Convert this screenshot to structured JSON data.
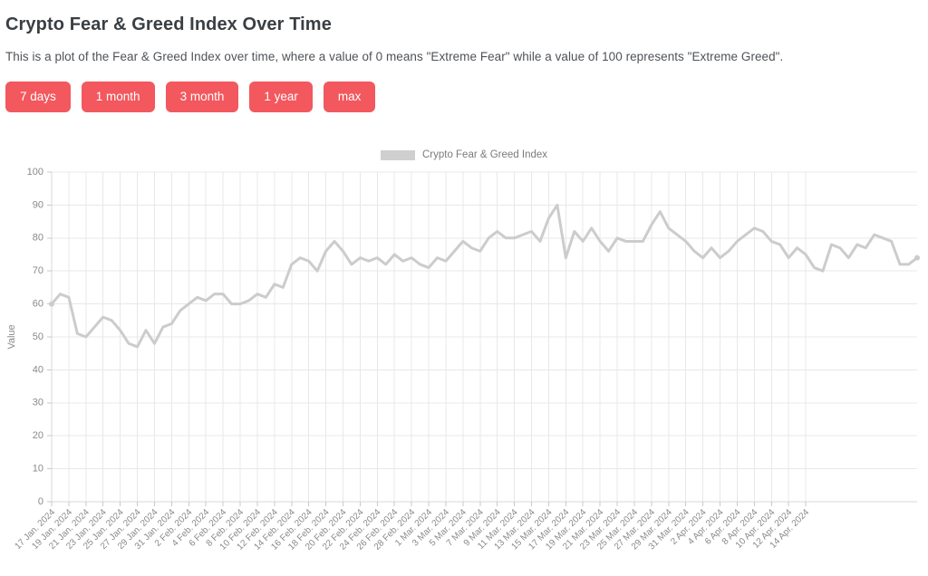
{
  "header": {
    "title": "Crypto Fear & Greed Index Over Time",
    "description": "This is a plot of the Fear & Greed Index over time, where a value of 0 means \"Extreme Fear\" while a value of 100 represents \"Extreme Greed\"."
  },
  "range_buttons": [
    {
      "label": "7 days"
    },
    {
      "label": "1 month"
    },
    {
      "label": "3 month"
    },
    {
      "label": "1 year"
    },
    {
      "label": "max"
    }
  ],
  "colors": {
    "button_background": "#f2585d",
    "button_text": "#ffffff",
    "series": "#cccccc",
    "grid": "#e8e8e8",
    "tick_text": "#8a8a8a",
    "title_text": "#3a3f44"
  },
  "chart_data": {
    "type": "line",
    "title": "",
    "xlabel": "",
    "ylabel": "Value",
    "ylim": [
      0,
      100
    ],
    "ytick_step": 10,
    "yticks": [
      0,
      10,
      20,
      30,
      40,
      50,
      60,
      70,
      80,
      90,
      100
    ],
    "grid": true,
    "legend_position": "top-center",
    "legend": [
      "Crypto Fear & Greed Index"
    ],
    "series": [
      {
        "name": "Crypto Fear & Greed Index",
        "color": "#cccccc",
        "values": [
          60,
          63,
          62,
          51,
          50,
          53,
          56,
          55,
          52,
          48,
          47,
          52,
          48,
          53,
          54,
          58,
          60,
          62,
          61,
          63,
          63,
          60,
          60,
          61,
          63,
          62,
          66,
          65,
          72,
          74,
          73,
          70,
          76,
          79,
          76,
          72,
          74,
          73,
          74,
          72,
          75,
          73,
          74,
          72,
          71,
          74,
          73,
          76,
          79,
          77,
          76,
          80,
          82,
          80,
          80,
          81,
          82,
          79,
          86,
          90,
          74,
          82,
          79,
          83,
          79,
          76,
          80,
          79,
          79,
          79,
          84,
          88,
          83,
          81,
          79,
          76,
          74,
          77,
          74,
          76,
          79,
          81,
          83,
          82,
          79,
          78,
          74,
          77,
          75,
          71,
          70,
          78,
          77,
          74,
          78,
          77,
          81,
          80,
          79,
          72,
          72,
          74
        ]
      }
    ],
    "x_start_date": "17 Jan. 2024",
    "x_end_date": "14 Apr. 2024",
    "xticks": [
      "17 Jan. 2024",
      "19 Jan. 2024",
      "21 Jan. 2024",
      "23 Jan. 2024",
      "25 Jan. 2024",
      "27 Jan. 2024",
      "29 Jan. 2024",
      "31 Jan. 2024",
      "2 Feb. 2024",
      "4 Feb. 2024",
      "6 Feb. 2024",
      "8 Feb. 2024",
      "10 Feb. 2024",
      "12 Feb. 2024",
      "14 Feb. 2024",
      "16 Feb. 2024",
      "18 Feb. 2024",
      "20 Feb. 2024",
      "22 Feb. 2024",
      "24 Feb. 2024",
      "26 Feb. 2024",
      "28 Feb. 2024",
      "1 Mar. 2024",
      "3 Mar. 2024",
      "5 Mar. 2024",
      "7 Mar. 2024",
      "9 Mar. 2024",
      "11 Mar. 2024",
      "13 Mar. 2024",
      "15 Mar. 2024",
      "17 Mar. 2024",
      "19 Mar. 2024",
      "21 Mar. 2024",
      "23 Mar. 2024",
      "25 Mar. 2024",
      "27 Mar. 2024",
      "29 Mar. 2024",
      "31 Mar. 2024",
      "2 Apr. 2024",
      "4 Apr. 2024",
      "6 Apr. 2024",
      "8 Apr. 2024",
      "10 Apr. 2024",
      "12 Apr. 2024",
      "14 Apr. 2024"
    ]
  }
}
